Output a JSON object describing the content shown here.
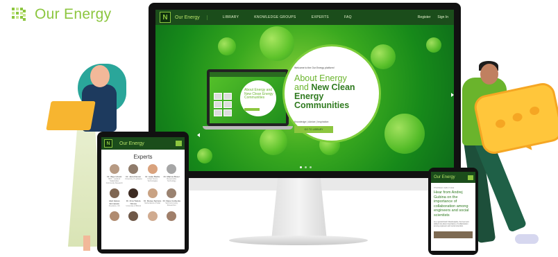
{
  "brand": {
    "name": "Our Energy",
    "logo_color": "#8cc63f"
  },
  "desktop": {
    "nav": {
      "logo_letter": "N",
      "brand": "Our Energy",
      "items": [
        "LIBRARY",
        "KNOWLEDGE GROUPS",
        "EXPERTS",
        "FAQ"
      ],
      "right": [
        "Register",
        "Sign In"
      ]
    },
    "hero": {
      "welcome": "Welcome to the Our Energy platform!",
      "title_line1": "About Energy",
      "title_line2a": "and ",
      "title_line2b": "New Clean",
      "title_line3": "Energy",
      "title_line4": "Communities",
      "tagline": "Knowledge | Advice | Inspiration",
      "button": "GO TO LIBRARY"
    },
    "laptop_title": "About Energy and New Clean Energy Communities"
  },
  "tablet": {
    "brand": "Our Energy",
    "page_title": "Experts",
    "experts": [
      {
        "name": "Dr. Iñigo Urresti",
        "role": "Birth · Lowland Stakeholder Community Research"
      },
      {
        "name": "Dr. Jana Ramon",
        "role": "University of Ljubljana"
      },
      {
        "name": "Dr. Lieke Backs",
        "role": "Urban Future Technologies"
      },
      {
        "name": "Dr. Marcus Boxer",
        "role": "Responsible Technology"
      },
      {
        "name": "Aled Hanes Emmanelo",
        "role": "Freelance, UK"
      },
      {
        "name": "Dr. Irina Todera Ninnes",
        "role": "University of Bristol"
      },
      {
        "name": "Dr. Renee Serrano",
        "role": "Netherlands of Solar"
      },
      {
        "name": "Dr. Dave Codvenia",
        "role": "Self-Community Researcher"
      }
    ]
  },
  "phone": {
    "brand": "Our Energy",
    "meta_date": "THURSDAY, FEB 17 2022",
    "headline": "Hear from Andrej Gubina on the importance of collaboration among engineers and social scientists",
    "body": "As a typical Dutch Woodcapelle, the hear and skilled role about importance of collaboration among engineers and social scientists"
  }
}
